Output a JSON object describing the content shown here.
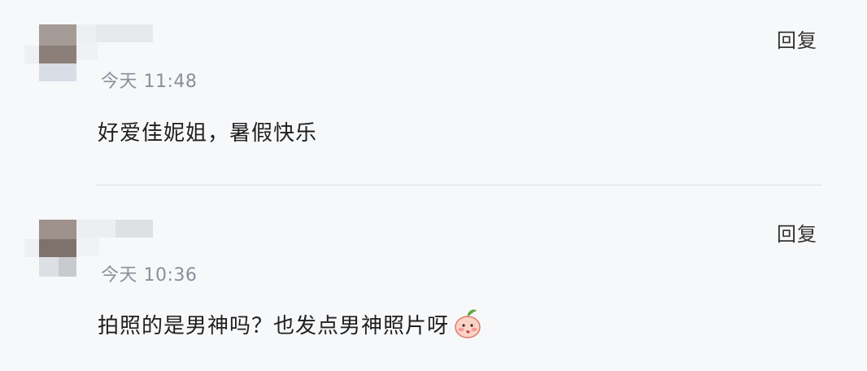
{
  "comments": [
    {
      "timestamp": "今天 11:48",
      "text": "好爱佳妮姐，暑假快乐",
      "reply_label": "回复"
    },
    {
      "timestamp": "今天 10:36",
      "text": "拍照的是男神吗？也发点男神照片呀",
      "reply_label": "回复",
      "emoji": "peach-blush-emoji"
    }
  ],
  "colors": {
    "background": "#f7f8fa",
    "text": "#1f1f1f",
    "timestamp": "#8a8f99",
    "divider": "#dcdde0"
  }
}
